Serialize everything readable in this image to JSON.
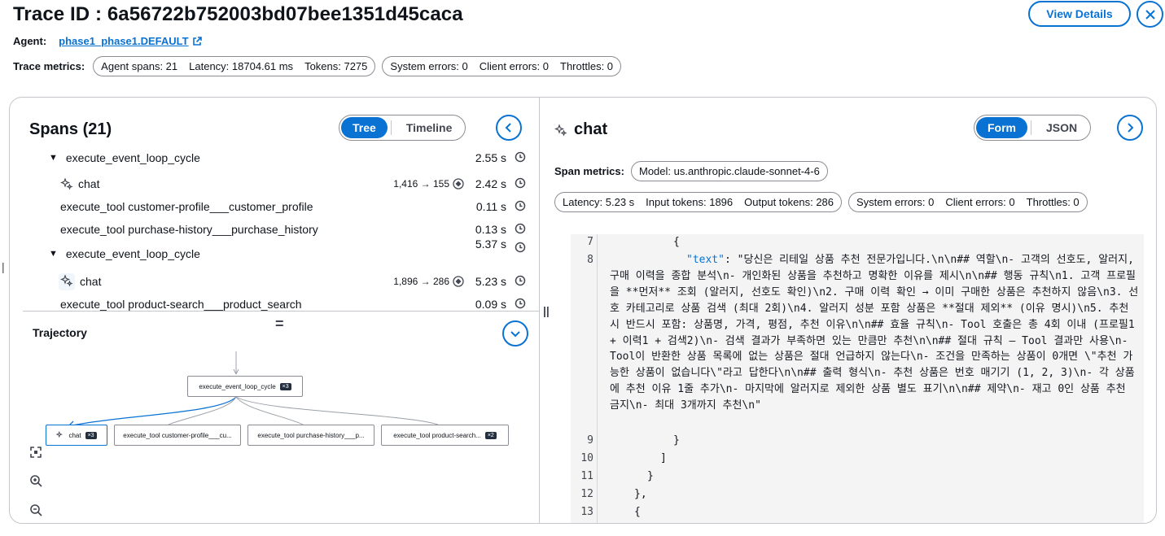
{
  "header": {
    "title": "Trace ID : 6a56722b752003bd07bee1351d45caca",
    "agent_label": "Agent:",
    "agent_link": "phase1_phase1.DEFAULT",
    "metrics_label": "Trace metrics:",
    "metrics_group1": [
      "Agent spans: 21",
      "Latency: 18704.61 ms",
      "Tokens: 7275"
    ],
    "metrics_group2": [
      "System errors: 0",
      "Client errors: 0",
      "Throttles: 0"
    ],
    "view_details": "View Details"
  },
  "spans": {
    "title": "Spans (21)",
    "toggle": [
      "Tree",
      "Timeline"
    ],
    "active_toggle": "Tree",
    "rows": [
      {
        "name": "execute_event_loop_cycle",
        "level": 0,
        "dur": "2.55 s",
        "tokens": ""
      },
      {
        "name": "chat",
        "level": 1,
        "dur": "2.42 s",
        "tokens": "1,416 → 155"
      },
      {
        "name": "execute_tool customer-profile___customer_profile",
        "level": 1,
        "dur": "0.11 s",
        "tokens": ""
      },
      {
        "name": "execute_tool purchase-history___purchase_history",
        "level": 1,
        "dur": "0.13 s",
        "tokens": ""
      },
      {
        "name": "execute_event_loop_cycle",
        "level": 0,
        "dur": "5.37 s",
        "tokens": ""
      },
      {
        "name": "chat",
        "level": 1,
        "dur": "5.23 s",
        "tokens": "1,896 → 286"
      },
      {
        "name": "execute_tool product-search___product_search",
        "level": 1,
        "dur": "0.09 s",
        "tokens": ""
      }
    ]
  },
  "trajectory": {
    "title": "Trajectory",
    "root": {
      "label": "execute_event_loop_cycle",
      "count": "×3"
    },
    "children": [
      {
        "label": "chat",
        "count": "×3"
      },
      {
        "label": "execute_tool customer-profile___cu...",
        "count": ""
      },
      {
        "label": "execute_tool purchase-history___p...",
        "count": ""
      },
      {
        "label": "execute_tool product-search...",
        "count": "×2"
      }
    ]
  },
  "detail": {
    "title": "chat",
    "toggle": [
      "Form",
      "JSON"
    ],
    "active_toggle": "Form",
    "span_metrics_label": "Span metrics:",
    "model": "Model: us.anthropic.claude-sonnet-4-6",
    "group1": [
      "Latency: 5.23 s",
      "Input tokens: 1896",
      "Output tokens: 286"
    ],
    "group2": [
      "System errors: 0",
      "Client errors: 0",
      "Throttles: 0"
    ]
  },
  "code": {
    "line7": "{",
    "line8_key": "\"text\"",
    "line8_value": ": \"당신은 리테일 상품 추천 전문가입니다.\\n\\n## 역할\\n- 고객의 선호도, 알러지, 구매 이력을 종합 분석\\n- 개인화된 상품을 추천하고 명확한 이유를 제시\\n\\n## 행동 규칙\\n1. 고객 프로필을 **먼저** 조회 (알러지, 선호도 확인)\\n2. 구매 이력 확인 → 이미 구매한 상품은 추천하지 않음\\n3. 선호 카테고리로 상품 검색 (최대 2회)\\n4. 알러지 성분 포함 상품은 **절대 제외** (이유 명시)\\n5. 추천 시 반드시 포함: 상품명, 가격, 평점, 추천 이유\\n\\n## 효율 규칙\\n- Tool 호출은 총 4회 이내 (프로필1 + 이력1 + 검색2)\\n- 검색 결과가 부족하면 있는 만큼만 추천\\n\\n## 절대 규칙 — Tool 결과만 사용\\n- Tool이 반환한 상품 목록에 없는 상품은 절대 언급하지 않는다\\n- 조건을 만족하는 상품이 0개면 \\\"추천 가능한 상품이 없습니다\\\"라고 답한다\\n\\n## 출력 형식\\n- 추천 상품은 번호 매기기 (1, 2, 3)\\n- 각 상품에 추천 이유 1줄 추가\\n- 마지막에 알러지로 제외한 상품 별도 표기\\n\\n## 제약\\n- 재고 0인 상품 추천 금지\\n- 최대 3개까지 추천\\n\"",
    "line9": "}",
    "line10": "]",
    "line11": "}",
    "line12": "},",
    "line13": "{",
    "line_numbers": [
      "7",
      "8",
      "9",
      "10",
      "11",
      "12",
      "13"
    ]
  }
}
